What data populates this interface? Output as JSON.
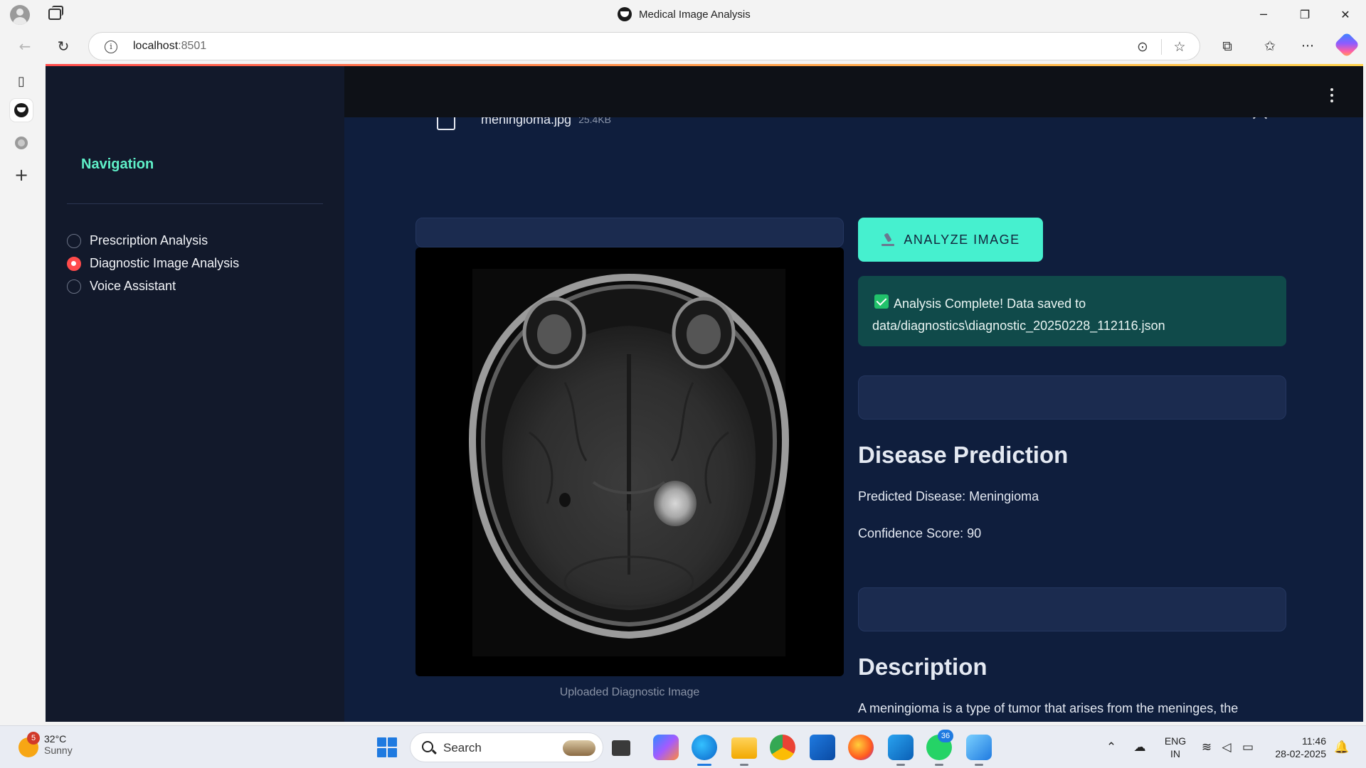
{
  "browser": {
    "window_title": "Medical Image Analysis",
    "url_host": "localhost",
    "url_port": ":8501",
    "controls": {
      "minimize": "─",
      "restore": "❐",
      "close": "✕"
    }
  },
  "sidebar": {
    "title": "Navigation",
    "options": [
      {
        "label": "Prescription Analysis",
        "selected": false
      },
      {
        "label": "Diagnostic Image Analysis",
        "selected": true
      },
      {
        "label": "Voice Assistant",
        "selected": false
      }
    ]
  },
  "main": {
    "file": {
      "name": "meningioma.jpg",
      "size": "25.4KB"
    },
    "image_caption": "Uploaded Diagnostic Image",
    "analyze_button": "ANALYZE IMAGE",
    "success_message": "Analysis Complete! Data saved to data/diagnostics\\diagnostic_20250228_112116.json",
    "prediction": {
      "heading": "Disease Prediction",
      "disease_line": "Predicted Disease: Meningioma",
      "confidence_line": "Confidence Score: 90"
    },
    "description": {
      "heading": "Description",
      "text": "A meningioma is a type of tumor that arises from the meninges, the protective membranes surrounding the brain and spinal cord. It is typically benign (non-cancerous) and can cause symptoms such as headaches, seizures, and cognitive impairment."
    }
  },
  "taskbar": {
    "weather": {
      "temp": "32°C",
      "condition": "Sunny",
      "badge": "5"
    },
    "search_placeholder": "Search",
    "whatsapp_badge": "36",
    "lang_primary": "ENG",
    "lang_secondary": "IN",
    "time": "11:46",
    "date": "28-02-2025"
  },
  "colors": {
    "accent": "#46f0cf",
    "nav_title": "#5ff0c8",
    "radio_selected": "#ff4b4b",
    "main_bg": "#0f1e3d",
    "sidebar_bg": "#12192b",
    "success_bg": "#104a4a"
  }
}
